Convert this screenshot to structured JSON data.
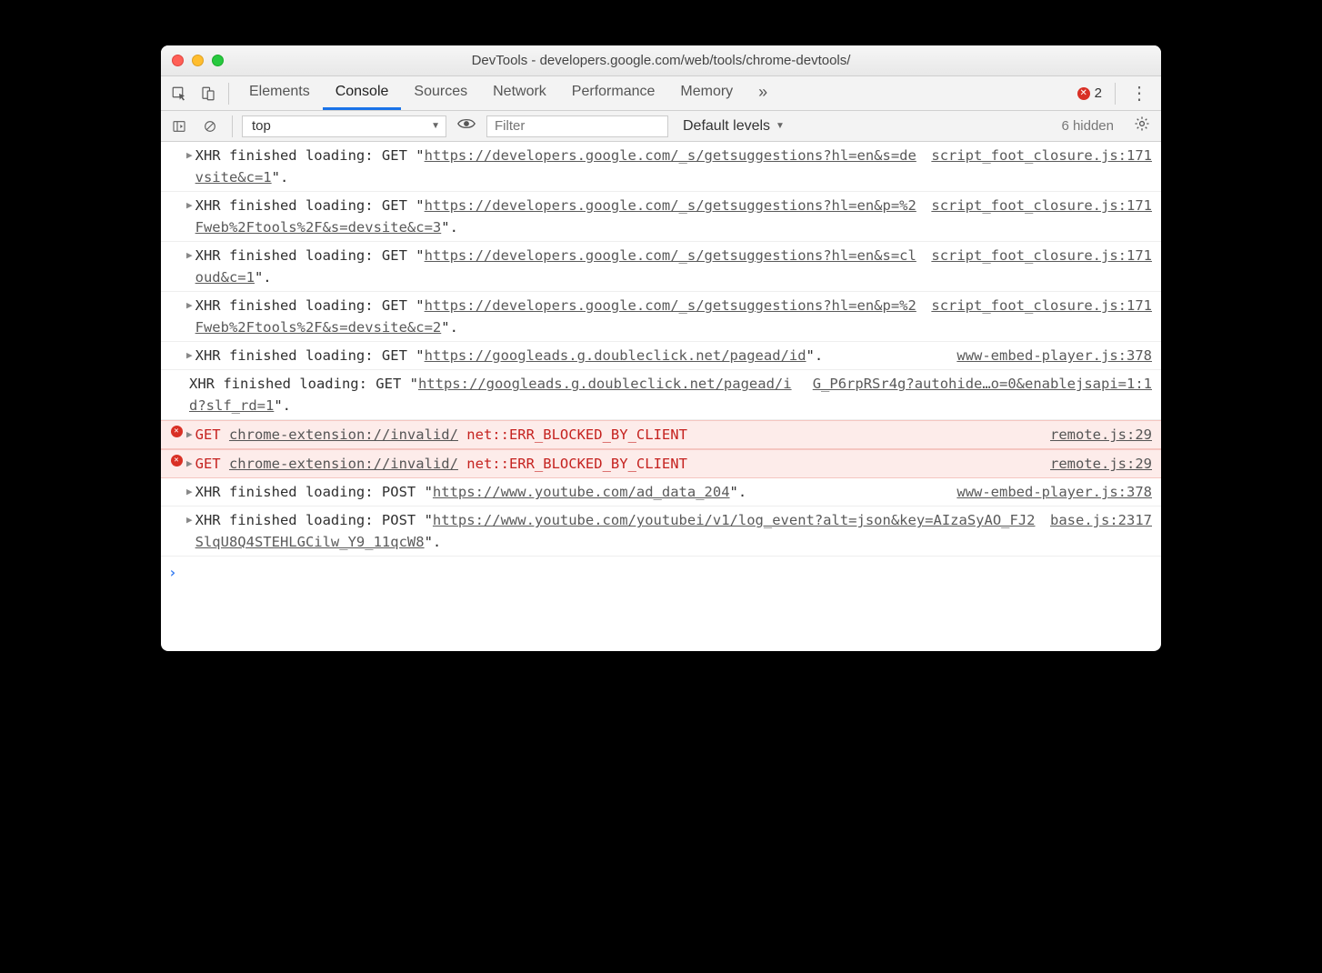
{
  "window": {
    "title": "DevTools - developers.google.com/web/tools/chrome-devtools/"
  },
  "toolbar": {
    "tabs": [
      "Elements",
      "Console",
      "Sources",
      "Network",
      "Performance",
      "Memory"
    ],
    "active_tab": "Console",
    "overflow": "»",
    "error_count": "2"
  },
  "filterbar": {
    "context": "top",
    "filter_placeholder": "Filter",
    "levels_label": "Default levels",
    "hidden_count": "6 hidden"
  },
  "logs": [
    {
      "type": "xhr",
      "prefix": "XHR finished loading: GET \"",
      "url": "https://developers.google.com/_s/getsuggestions?hl=en&s=devsite&c=1",
      "suffix": "\".",
      "source": "script_foot_closure.js:171",
      "expand": true
    },
    {
      "type": "xhr",
      "prefix": "XHR finished loading: GET \"",
      "url": "https://developers.google.com/_s/getsuggestions?hl=en&p=%2Fweb%2Ftools%2F&s=devsite&c=3",
      "suffix": "\".",
      "source": "script_foot_closure.js:171",
      "expand": true
    },
    {
      "type": "xhr",
      "prefix": "XHR finished loading: GET \"",
      "url": "https://developers.google.com/_s/getsuggestions?hl=en&s=cloud&c=1",
      "suffix": "\".",
      "source": "script_foot_closure.js:171",
      "expand": true
    },
    {
      "type": "xhr",
      "prefix": "XHR finished loading: GET \"",
      "url": "https://developers.google.com/_s/getsuggestions?hl=en&p=%2Fweb%2Ftools%2F&s=devsite&c=2",
      "suffix": "\".",
      "source": "script_foot_closure.js:171",
      "expand": true
    },
    {
      "type": "xhr",
      "prefix": "XHR finished loading: GET \"",
      "url": "https://googleads.g.doubleclick.net/pagead/id",
      "suffix": "\".",
      "source": "www-embed-player.js:378",
      "expand": true
    },
    {
      "type": "xhr",
      "prefix": "XHR finished loading: GET \"",
      "url": "https://googleads.g.doubleclick.net/pagead/id?slf_rd=1",
      "suffix": "\".",
      "source": "G_P6rpRSr4g?autohide…o=0&enablejsapi=1:1",
      "expand": false
    },
    {
      "type": "err",
      "method": "GET",
      "url": "chrome-extension://invalid/",
      "err": "net::ERR_BLOCKED_BY_CLIENT",
      "source": "remote.js:29"
    },
    {
      "type": "err",
      "method": "GET",
      "url": "chrome-extension://invalid/",
      "err": "net::ERR_BLOCKED_BY_CLIENT",
      "source": "remote.js:29"
    },
    {
      "type": "xhr",
      "prefix": "XHR finished loading: POST \"",
      "url": "https://www.youtube.com/ad_data_204",
      "suffix": "\".",
      "source": "www-embed-player.js:378",
      "expand": true
    },
    {
      "type": "xhr",
      "prefix": "XHR finished loading: POST \"",
      "url": "https://www.youtube.com/youtubei/v1/log_event?alt=json&key=AIzaSyAO_FJ2SlqU8Q4STEHLGCilw_Y9_11qcW8",
      "suffix": "\".",
      "source": "base.js:2317",
      "expand": true
    }
  ]
}
